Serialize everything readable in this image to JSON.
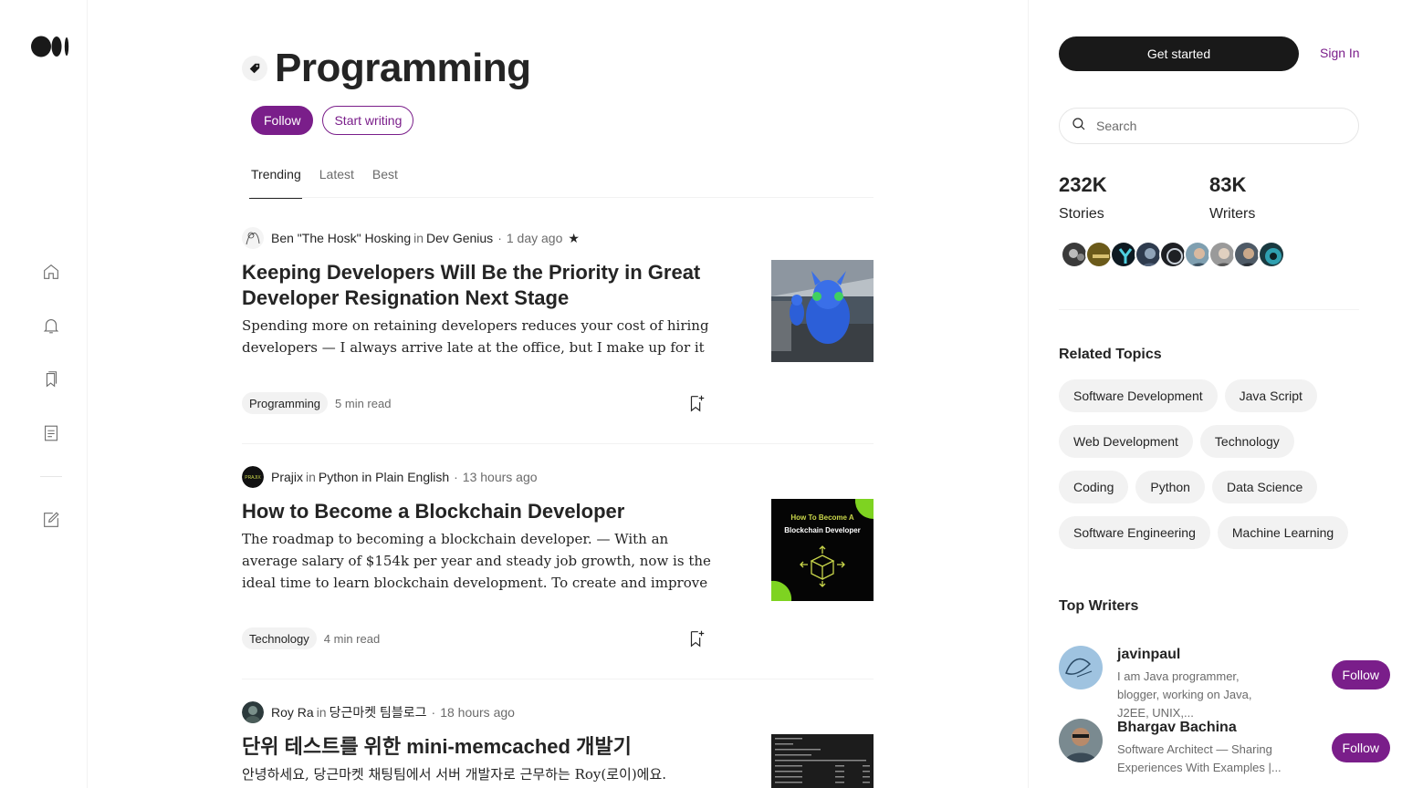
{
  "nav": {
    "icons": [
      "medium-logo",
      "home-icon",
      "bell-icon",
      "bookmarks-icon",
      "stories-icon",
      "write-icon"
    ]
  },
  "topic": {
    "title": "Programming",
    "follow_label": "Follow",
    "start_writing_label": "Start writing"
  },
  "tabs": [
    {
      "label": "Trending",
      "active": true
    },
    {
      "label": "Latest",
      "active": false
    },
    {
      "label": "Best",
      "active": false
    }
  ],
  "articles": [
    {
      "author": "Ben \"The Hosk\" Hosking",
      "in": "in",
      "publication": "Dev Genius",
      "time": "1 day ago",
      "star": "★",
      "title": "Keeping Developers Will Be the Priority in Great Developer Resignation Next Stage",
      "subtitle": "Spending more on retaining developers reduces your cost of hiring developers — I always arrive late at the office, but I make up for it by…",
      "tag": "Programming",
      "read_time": "5 min read"
    },
    {
      "author": "Prajix",
      "in": "in",
      "publication": "Python in Plain English",
      "time": "13 hours ago",
      "title": "How to Become a Blockchain Developer",
      "subtitle": "The roadmap to becoming a blockchain developer. — With an average salary of $154k per year and steady job growth, now is the ideal time to learn blockchain development. To create and improve blockchain…",
      "tag": "Technology",
      "read_time": "4 min read",
      "thumb_text_1": "How To Become A",
      "thumb_text_2": "Blockchain Developer"
    },
    {
      "author": "Roy Ra",
      "in": "in",
      "publication": "당근마켓 팀블로그",
      "time": "18 hours ago",
      "title": "단위 테스트를 위한 mini-memcached 개발기",
      "subtitle": "안녕하세요, 당근마켓 채팅팀에서 서버 개발자로 근무하는 Roy(로이)에요."
    }
  ],
  "sidebar": {
    "get_started_label": "Get started",
    "sign_in_label": "Sign In",
    "search_placeholder": "Search",
    "stories_count": "232K",
    "stories_label": "Stories",
    "writers_count": "83K",
    "writers_label": "Writers",
    "related_topics_heading": "Related Topics",
    "related_topics": [
      "Software Development",
      "Java Script",
      "Web Development",
      "Technology",
      "Coding",
      "Python",
      "Data Science",
      "Software Engineering",
      "Machine Learning"
    ],
    "top_writers_heading": "Top Writers",
    "top_writers": [
      {
        "name": "javinpaul",
        "bio": "I am Java programmer, blogger, working on Java, J2EE, UNIX,...",
        "follow_label": "Follow"
      },
      {
        "name": "Bhargav Bachina",
        "bio": "Software Architect — Sharing Experiences With Examples |...",
        "follow_label": "Follow"
      }
    ]
  },
  "colors": {
    "accent": "#7a1e8a",
    "text": "#242424",
    "muted": "#6b6b6b",
    "chip_bg": "#f2f2f2",
    "dark_button": "#191919"
  }
}
